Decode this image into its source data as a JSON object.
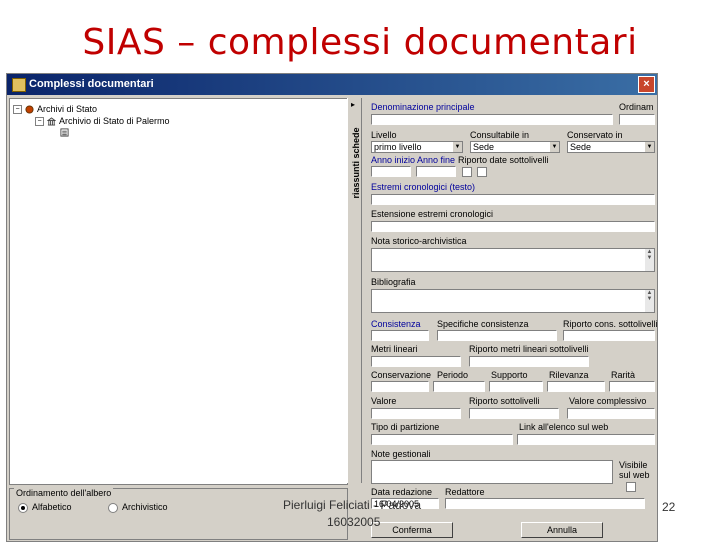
{
  "slide": {
    "title": "SIAS – complessi documentari",
    "footer_author": "Pierluigi Feliciati - Padova",
    "footer_date": "16032005",
    "page_number": "22"
  },
  "window": {
    "title": "Complessi documentari",
    "close_label": "×"
  },
  "tree": {
    "nodes": [
      {
        "toggle": "−",
        "label": "Archivi di Stato"
      },
      {
        "toggle": "−",
        "label": "Archivio di Stato di Palermo"
      },
      {
        "toggle": "",
        "label": ""
      }
    ]
  },
  "side_tab": {
    "label": "riassunti schede",
    "arrow": "▸"
  },
  "form": {
    "denominazione_label": "Denominazione principale",
    "ordinam_label": "Ordinam",
    "livello_label": "Livello",
    "livello_value": "primo livello",
    "consultabile_label": "Consultabile in",
    "consultabile_value": "Sede",
    "conservato_label": "Conservato in",
    "conservato_value": "Sede",
    "anno_label": "Anno inizio Anno fine",
    "riporto_date_label": "Riporto date sottolivelli",
    "estremi_label": "Estremi cronologici (testo)",
    "estensione_label": "Estensione estremi cronologici",
    "nota_storico_label": "Nota storico-archivistica",
    "bibliografia_label": "Bibliografia",
    "consistenza_label": "Consistenza",
    "specifiche_label": "Specifiche consistenza",
    "riporto_cons_label": "Riporto cons. sottolivelli",
    "metri_label": "Metri lineari",
    "riporto_metri_label": "Riporto metri lineari sottolivelli",
    "conservazione_label": "Conservazione",
    "periodo_label": "Periodo",
    "supporto_label": "Supporto",
    "rilevanza_label": "Rilevanza",
    "rarita_label": "Rarità",
    "valore_label": "Valore",
    "riporto_sottolivelli_label": "Riporto sottolivelli",
    "valore_complessivo_label": "Valore complessivo",
    "tipo_label": "Tipo di partizione",
    "link_label": "Link all'elenco sul web",
    "note_gestionali_label": "Note gestionali",
    "visibile_label": "Visibile sul web",
    "data_redazione_label": "Data redazione",
    "redattore_label": "Redattore",
    "data_redazione_value": "16/04/2005"
  },
  "buttons": {
    "conferma": "Conferma",
    "annulla": "Annulla"
  },
  "ordinamento": {
    "group_label": "Ordinamento dell'albero",
    "option_alfabetico": "Alfabetico",
    "option_archivistico": "Archivistico",
    "selected": "Alfabetico"
  },
  "icons": {
    "tree_root": "archive-root-icon",
    "tree_building": "building-icon",
    "tree_document": "document-icon"
  },
  "colors": {
    "title_red": "#c00000",
    "titlebar_start": "#0a246a",
    "titlebar_end": "#3a6ea5",
    "label_blue": "#00009c"
  }
}
